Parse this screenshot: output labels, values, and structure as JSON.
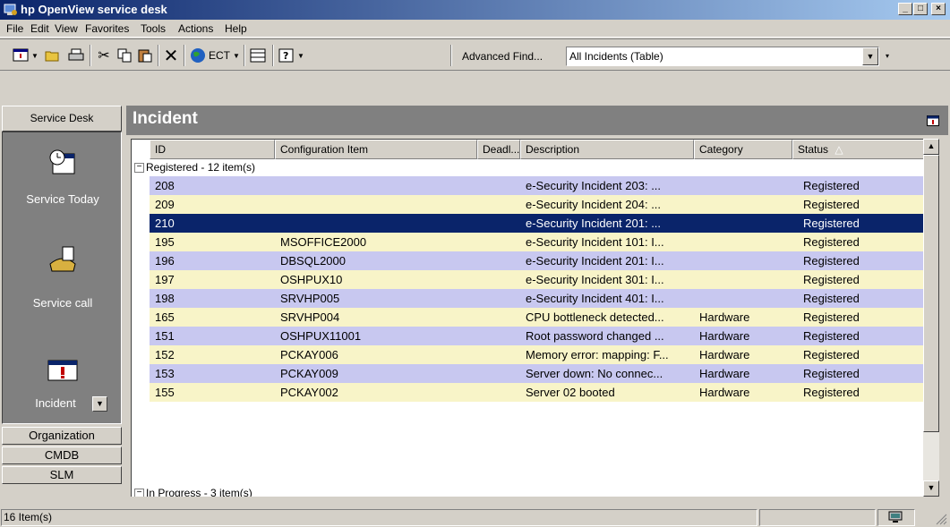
{
  "window": {
    "title": "hp OpenView service desk",
    "minimize": "_",
    "maximize": "□",
    "close": "×"
  },
  "menu": [
    "File",
    "Edit",
    "View",
    "Favorites",
    "Tools",
    "Actions",
    "Help"
  ],
  "toolbar": {
    "ect_label": "ECT",
    "advanced_find": "Advanced Find...",
    "view_selector": "All Incidents (Table)"
  },
  "sidebar": {
    "header": "Service Desk",
    "items": [
      "Service Today",
      "Service call",
      "Incident"
    ],
    "buttons": [
      "Organization",
      "CMDB",
      "SLM"
    ]
  },
  "panel": {
    "title": "Incident"
  },
  "table": {
    "columns": [
      "ID",
      "Configuration Item",
      "Deadl...",
      "Description",
      "Category",
      "Status"
    ],
    "sort_indicator": "△",
    "groups": [
      "Registered - 12 item(s)",
      "In Progress - 3 item(s)"
    ],
    "rows": [
      {
        "id": "208",
        "ci": "",
        "deadline": "",
        "description": "e-Security Incident 203: ...",
        "category": "",
        "status": "Registered"
      },
      {
        "id": "209",
        "ci": "",
        "deadline": "",
        "description": "e-Security Incident 204: ...",
        "category": "",
        "status": "Registered"
      },
      {
        "id": "210",
        "ci": "",
        "deadline": "",
        "description": "e-Security Incident 201: ...",
        "category": "",
        "status": "Registered"
      },
      {
        "id": "195",
        "ci": "MSOFFICE2000",
        "deadline": "",
        "description": "e-Security Incident 101: I...",
        "category": "",
        "status": "Registered"
      },
      {
        "id": "196",
        "ci": "DBSQL2000",
        "deadline": "",
        "description": "e-Security Incident 201: I...",
        "category": "",
        "status": "Registered"
      },
      {
        "id": "197",
        "ci": "OSHPUX10",
        "deadline": "",
        "description": "e-Security Incident 301: I...",
        "category": "",
        "status": "Registered"
      },
      {
        "id": "198",
        "ci": "SRVHP005",
        "deadline": "",
        "description": "e-Security Incident 401: I...",
        "category": "",
        "status": "Registered"
      },
      {
        "id": "165",
        "ci": "SRVHP004",
        "deadline": "",
        "description": "CPU bottleneck detected...",
        "category": "Hardware",
        "status": "Registered"
      },
      {
        "id": "151",
        "ci": "OSHPUX11001",
        "deadline": "",
        "description": "Root password changed ...",
        "category": "Hardware",
        "status": "Registered"
      },
      {
        "id": "152",
        "ci": "PCKAY006",
        "deadline": "",
        "description": "Memory error: mapping: F...",
        "category": "Hardware",
        "status": "Registered"
      },
      {
        "id": "153",
        "ci": "PCKAY009",
        "deadline": "",
        "description": "Server down: No connec...",
        "category": "Hardware",
        "status": "Registered"
      },
      {
        "id": "155",
        "ci": "PCKAY002",
        "deadline": "",
        "description": "Server 02 booted",
        "category": "Hardware",
        "status": "Registered"
      }
    ]
  },
  "status_bar": {
    "count": "16 Item(s)"
  },
  "colors": {
    "title_gradient_start": "#0a246a",
    "row_blue": "#c8c8f0",
    "row_yellow": "#f8f4c8",
    "row_selected": "#0a246a"
  }
}
